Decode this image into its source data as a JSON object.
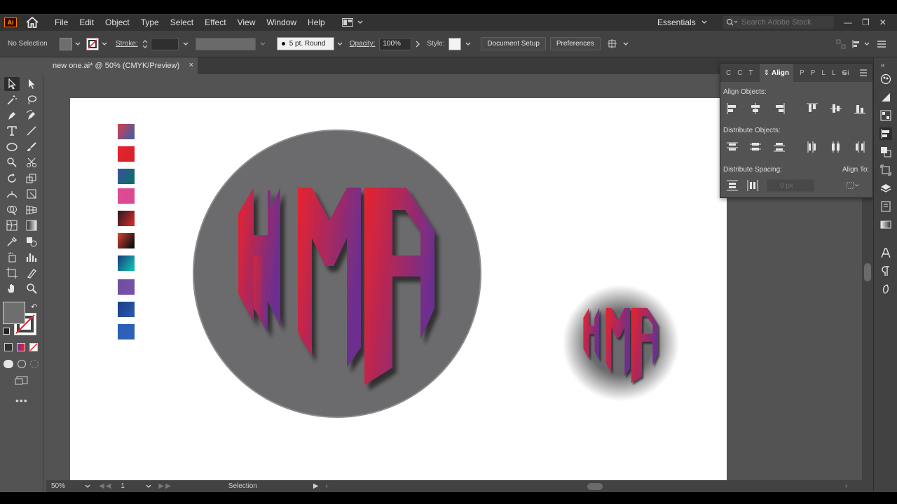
{
  "app": {
    "logo": "Ai"
  },
  "menu": [
    "File",
    "Edit",
    "Object",
    "Type",
    "Select",
    "Effect",
    "View",
    "Window",
    "Help"
  ],
  "workspace": {
    "name": "Essentials",
    "search_placeholder": "Search Adobe Stock"
  },
  "control": {
    "selection_label": "No Selection",
    "stroke_label": "Stroke:",
    "brush_label": "5 pt. Round",
    "opacity_label": "Opacity:",
    "opacity_value": "100%",
    "style_label": "Style:",
    "document_setup": "Document Setup",
    "preferences": "Preferences"
  },
  "document_tab": {
    "title": "new one.ai* @ 50% (CMYK/Preview)",
    "close": "×"
  },
  "status": {
    "zoom": "50%",
    "artboard": "1",
    "tool": "Selection"
  },
  "align_panel": {
    "tabs_left": [
      "C",
      "C",
      "T"
    ],
    "active_tab": "Align",
    "tabs_right": [
      "P",
      "P",
      "L",
      "L",
      "Gi"
    ],
    "align_objects": "Align Objects:",
    "distribute_objects": "Distribute Objects:",
    "distribute_spacing": "Distribute Spacing:",
    "align_to": "Align To:",
    "spacing_value": "0 px"
  },
  "artwork": {
    "logo_text": "HMA",
    "circle_color": "#6b6b6d",
    "gradient_start": "#e8232d",
    "gradient_end": "#6c2f8f",
    "swatches": [
      [
        "#d2404a",
        "#4f5a9e"
      ],
      [
        "#e8232d",
        "#d6222a"
      ],
      [
        "#3d4f9f",
        "#0c6d6a"
      ],
      [
        "#e04b98",
        "#d94a8e"
      ],
      [
        "#1e1e1e",
        "#c8262a"
      ],
      [
        "#d94232",
        "#111111"
      ],
      [
        "#1a3a7a",
        "#12b4b0"
      ],
      [
        "#6f4ea1",
        "#7650a8"
      ],
      [
        "#173f8a",
        "#2a55a5"
      ],
      [
        "#2a5fb5",
        "#2c62b8"
      ]
    ]
  }
}
